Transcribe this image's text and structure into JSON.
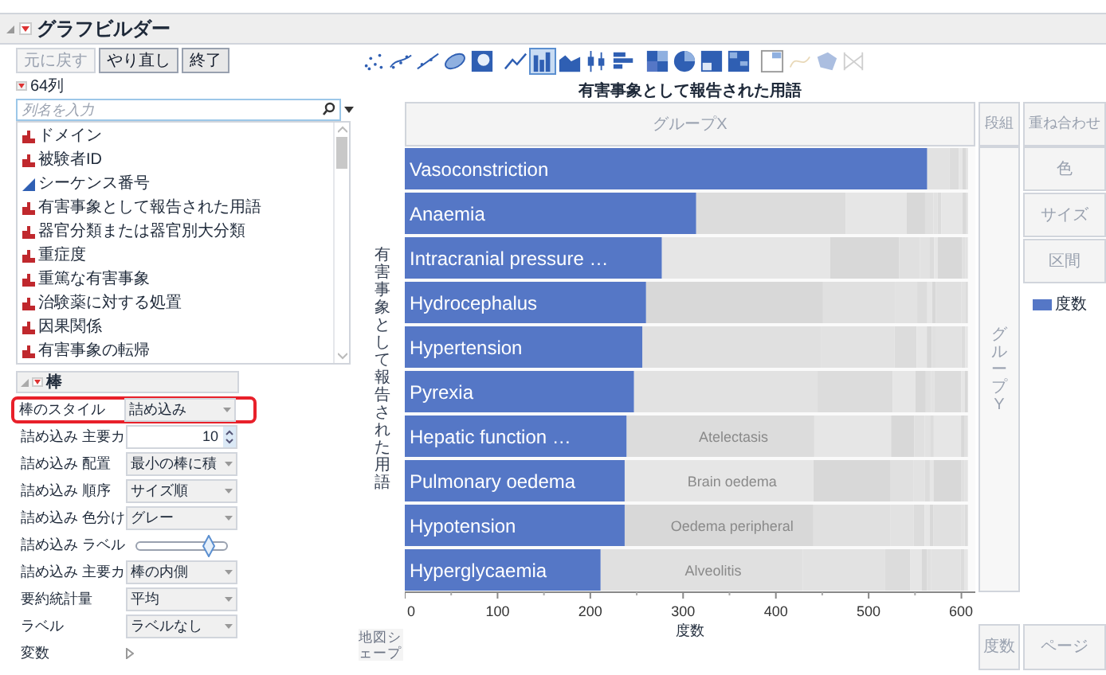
{
  "window": {
    "title": "グラフビルダー"
  },
  "buttons": [
    {
      "label": "元に戻す",
      "disabled": true
    },
    {
      "label": "やり直し",
      "disabled": false
    },
    {
      "label": "終了",
      "disabled": false
    }
  ],
  "columns_header": "64列",
  "search": {
    "placeholder": "列名を入力"
  },
  "columns": [
    {
      "label": "ドメイン",
      "kind": "nominal"
    },
    {
      "label": "被験者ID",
      "kind": "nominal"
    },
    {
      "label": "シーケンス番号",
      "kind": "continuous"
    },
    {
      "label": "有害事象として報告された用語",
      "kind": "nominal"
    },
    {
      "label": "器官分類または器官別大分類",
      "kind": "nominal"
    },
    {
      "label": "重症度",
      "kind": "nominal"
    },
    {
      "label": "重篤な有害事象",
      "kind": "nominal"
    },
    {
      "label": "治験薬に対する処置",
      "kind": "nominal"
    },
    {
      "label": "因果関係",
      "kind": "nominal"
    },
    {
      "label": "有害事象の転帰",
      "kind": "nominal"
    }
  ],
  "properties": {
    "title": "棒",
    "rows": [
      {
        "label": "棒のスタイル",
        "kind": "select",
        "value": "詰め込み",
        "highlighted": true
      },
      {
        "label": "詰め込み 主要カ",
        "kind": "spinner",
        "value": "10",
        "highlighted": false
      },
      {
        "label": "詰め込み 配置",
        "kind": "select",
        "value": "最小の棒に積",
        "highlighted": false
      },
      {
        "label": "詰め込み 順序",
        "kind": "select",
        "value": "サイズ順",
        "highlighted": false
      },
      {
        "label": "詰め込み 色分け",
        "kind": "select",
        "value": "グレー",
        "highlighted": false
      },
      {
        "label": "詰め込み ラベル",
        "kind": "slider",
        "level": 0.8,
        "highlighted": false
      },
      {
        "label": "詰め込み 主要カ",
        "kind": "select",
        "value": "棒の内側",
        "highlighted": false
      },
      {
        "label": "要約統計量",
        "kind": "select",
        "value": "平均",
        "highlighted": false
      },
      {
        "label": "ラベル",
        "kind": "select",
        "value": "ラベルなし",
        "highlighted": false
      },
      {
        "label": "変数",
        "kind": "expander",
        "highlighted": false
      }
    ]
  },
  "graph_types": [
    {
      "kind": "points",
      "selected": false,
      "disabled": false
    },
    {
      "kind": "smoother",
      "selected": false,
      "disabled": false
    },
    {
      "kind": "line-fit",
      "selected": false,
      "disabled": false
    },
    {
      "kind": "ellipse",
      "selected": false,
      "disabled": false
    },
    {
      "kind": "contour",
      "selected": false,
      "disabled": false
    },
    {
      "kind": "line",
      "selected": false,
      "disabled": false
    },
    {
      "kind": "bar",
      "selected": true,
      "disabled": false
    },
    {
      "kind": "area",
      "selected": false,
      "disabled": false
    },
    {
      "kind": "box",
      "selected": false,
      "disabled": false
    },
    {
      "kind": "histogram",
      "selected": false,
      "disabled": false
    },
    {
      "kind": "heatmap",
      "selected": false,
      "disabled": false
    },
    {
      "kind": "pie",
      "selected": false,
      "disabled": false
    },
    {
      "kind": "treemap",
      "selected": false,
      "disabled": false
    },
    {
      "kind": "mosaic",
      "selected": false,
      "disabled": false
    },
    {
      "kind": "caption",
      "selected": false,
      "disabled": false
    },
    {
      "kind": "formula",
      "selected": false,
      "disabled": true
    },
    {
      "kind": "map",
      "selected": false,
      "disabled": true
    },
    {
      "kind": "parallel",
      "selected": false,
      "disabled": true
    }
  ],
  "zones": {
    "group_x": "グループX",
    "wrap": "段組",
    "overlay": "重ね合わせ",
    "color_role": "色",
    "size": "サイズ",
    "interval": "区間",
    "group_y": "グループY",
    "freq": "度数",
    "page": "ページ",
    "map_shape": "地図シェープ"
  },
  "legend": [
    {
      "label": "度数",
      "color": "#5577c6"
    }
  ],
  "chart_data": {
    "type": "bar",
    "orientation": "horizontal",
    "title": "有害事象として報告された用語",
    "xlabel": "度数",
    "ylabel": "有害事象として報告された用語",
    "categories": [
      "Vasoconstriction",
      "Anaemia",
      "Intracranial pressure …",
      "Hydrocephalus",
      "Hypertension",
      "Pyrexia",
      "Hepatic function …",
      "Pulmonary oedema",
      "Hypotension",
      "Hyperglycaemia"
    ],
    "values": [
      563,
      314,
      277,
      260,
      256,
      247,
      239,
      237,
      237,
      211
    ],
    "xlim": [
      0,
      615
    ],
    "xticks": [
      0,
      100,
      200,
      300,
      400,
      500,
      600
    ],
    "annotations": [
      "Atelectasis",
      "Brain oedema",
      "Oedema peripheral",
      "Alveolitis"
    ]
  }
}
